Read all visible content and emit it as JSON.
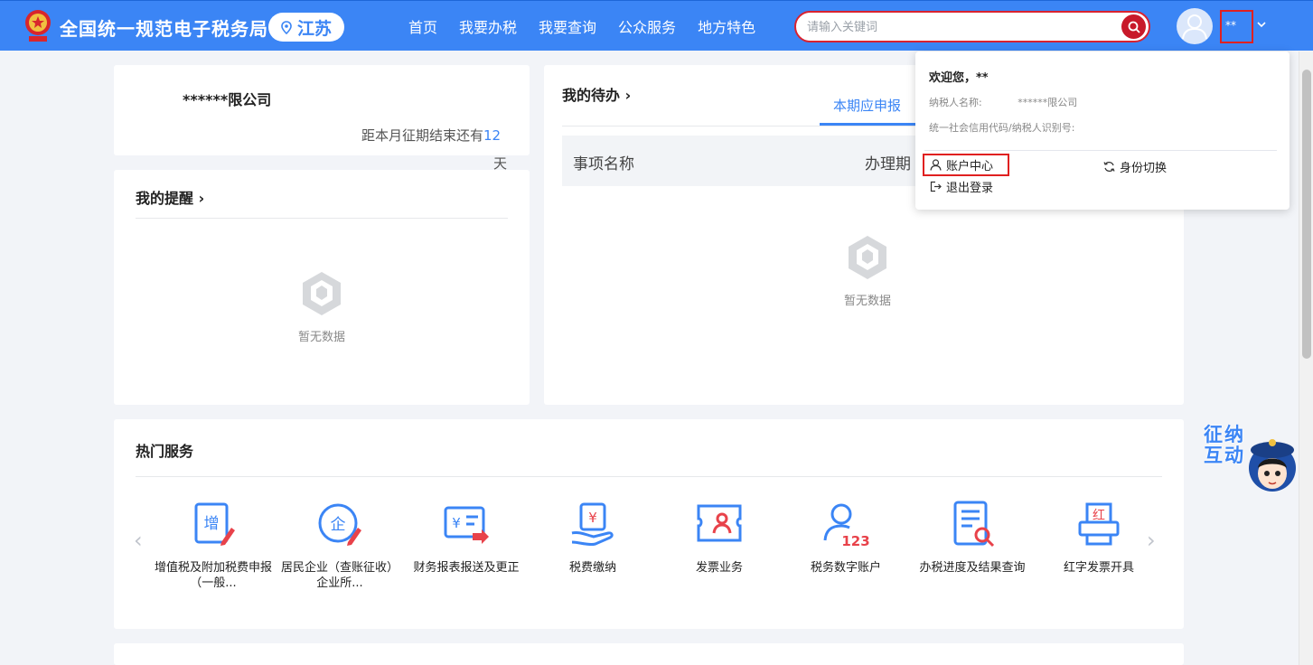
{
  "header": {
    "site_title": "全国统一规范电子税务局",
    "region": "江苏",
    "nav": [
      "首页",
      "我要办税",
      "我要查询",
      "公众服务",
      "地方特色"
    ],
    "search_placeholder": "请输入关键词",
    "user_name": "**"
  },
  "company_card": {
    "company_name": "******限公司",
    "deadline_prefix": "距本月征期结束还有",
    "deadline_days": "12",
    "deadline_unit": "天"
  },
  "reminders": {
    "title": "我的提醒",
    "empty_text": "暂无数据"
  },
  "todo": {
    "title": "我的待办",
    "active_tab": "本期应申报",
    "columns": [
      "事项名称",
      "办理期"
    ],
    "empty_text": "暂无数据"
  },
  "hot_services": {
    "title": "热门服务",
    "items": [
      {
        "label": "增值税及附加税费申报（一般...",
        "icon": "vat-declaration-icon"
      },
      {
        "label": "居民企业（查账征收）企业所...",
        "icon": "enterprise-tax-icon"
      },
      {
        "label": "财务报表报送及更正",
        "icon": "financial-report-icon"
      },
      {
        "label": "税费缴纳",
        "icon": "tax-payment-icon"
      },
      {
        "label": "发票业务",
        "icon": "invoice-icon"
      },
      {
        "label": "税务数字账户",
        "icon": "digital-account-icon"
      },
      {
        "label": "办税进度及结果查询",
        "icon": "progress-query-icon"
      },
      {
        "label": "红字发票开具",
        "icon": "red-invoice-icon"
      }
    ]
  },
  "user_dropdown": {
    "welcome": "欢迎您，**",
    "taxpayer_label": "纳税人名称:",
    "taxpayer_value": "******限公司",
    "credit_code_label": "统一社会信用代码/纳税人识别号:",
    "account_center": "账户中心",
    "switch_identity": "身份切换",
    "logout": "退出登录"
  },
  "assistant": {
    "text": "征纳互动"
  },
  "colors": {
    "primary": "#3b85f5",
    "highlight": "#e02020",
    "search_button": "#c8192a"
  }
}
